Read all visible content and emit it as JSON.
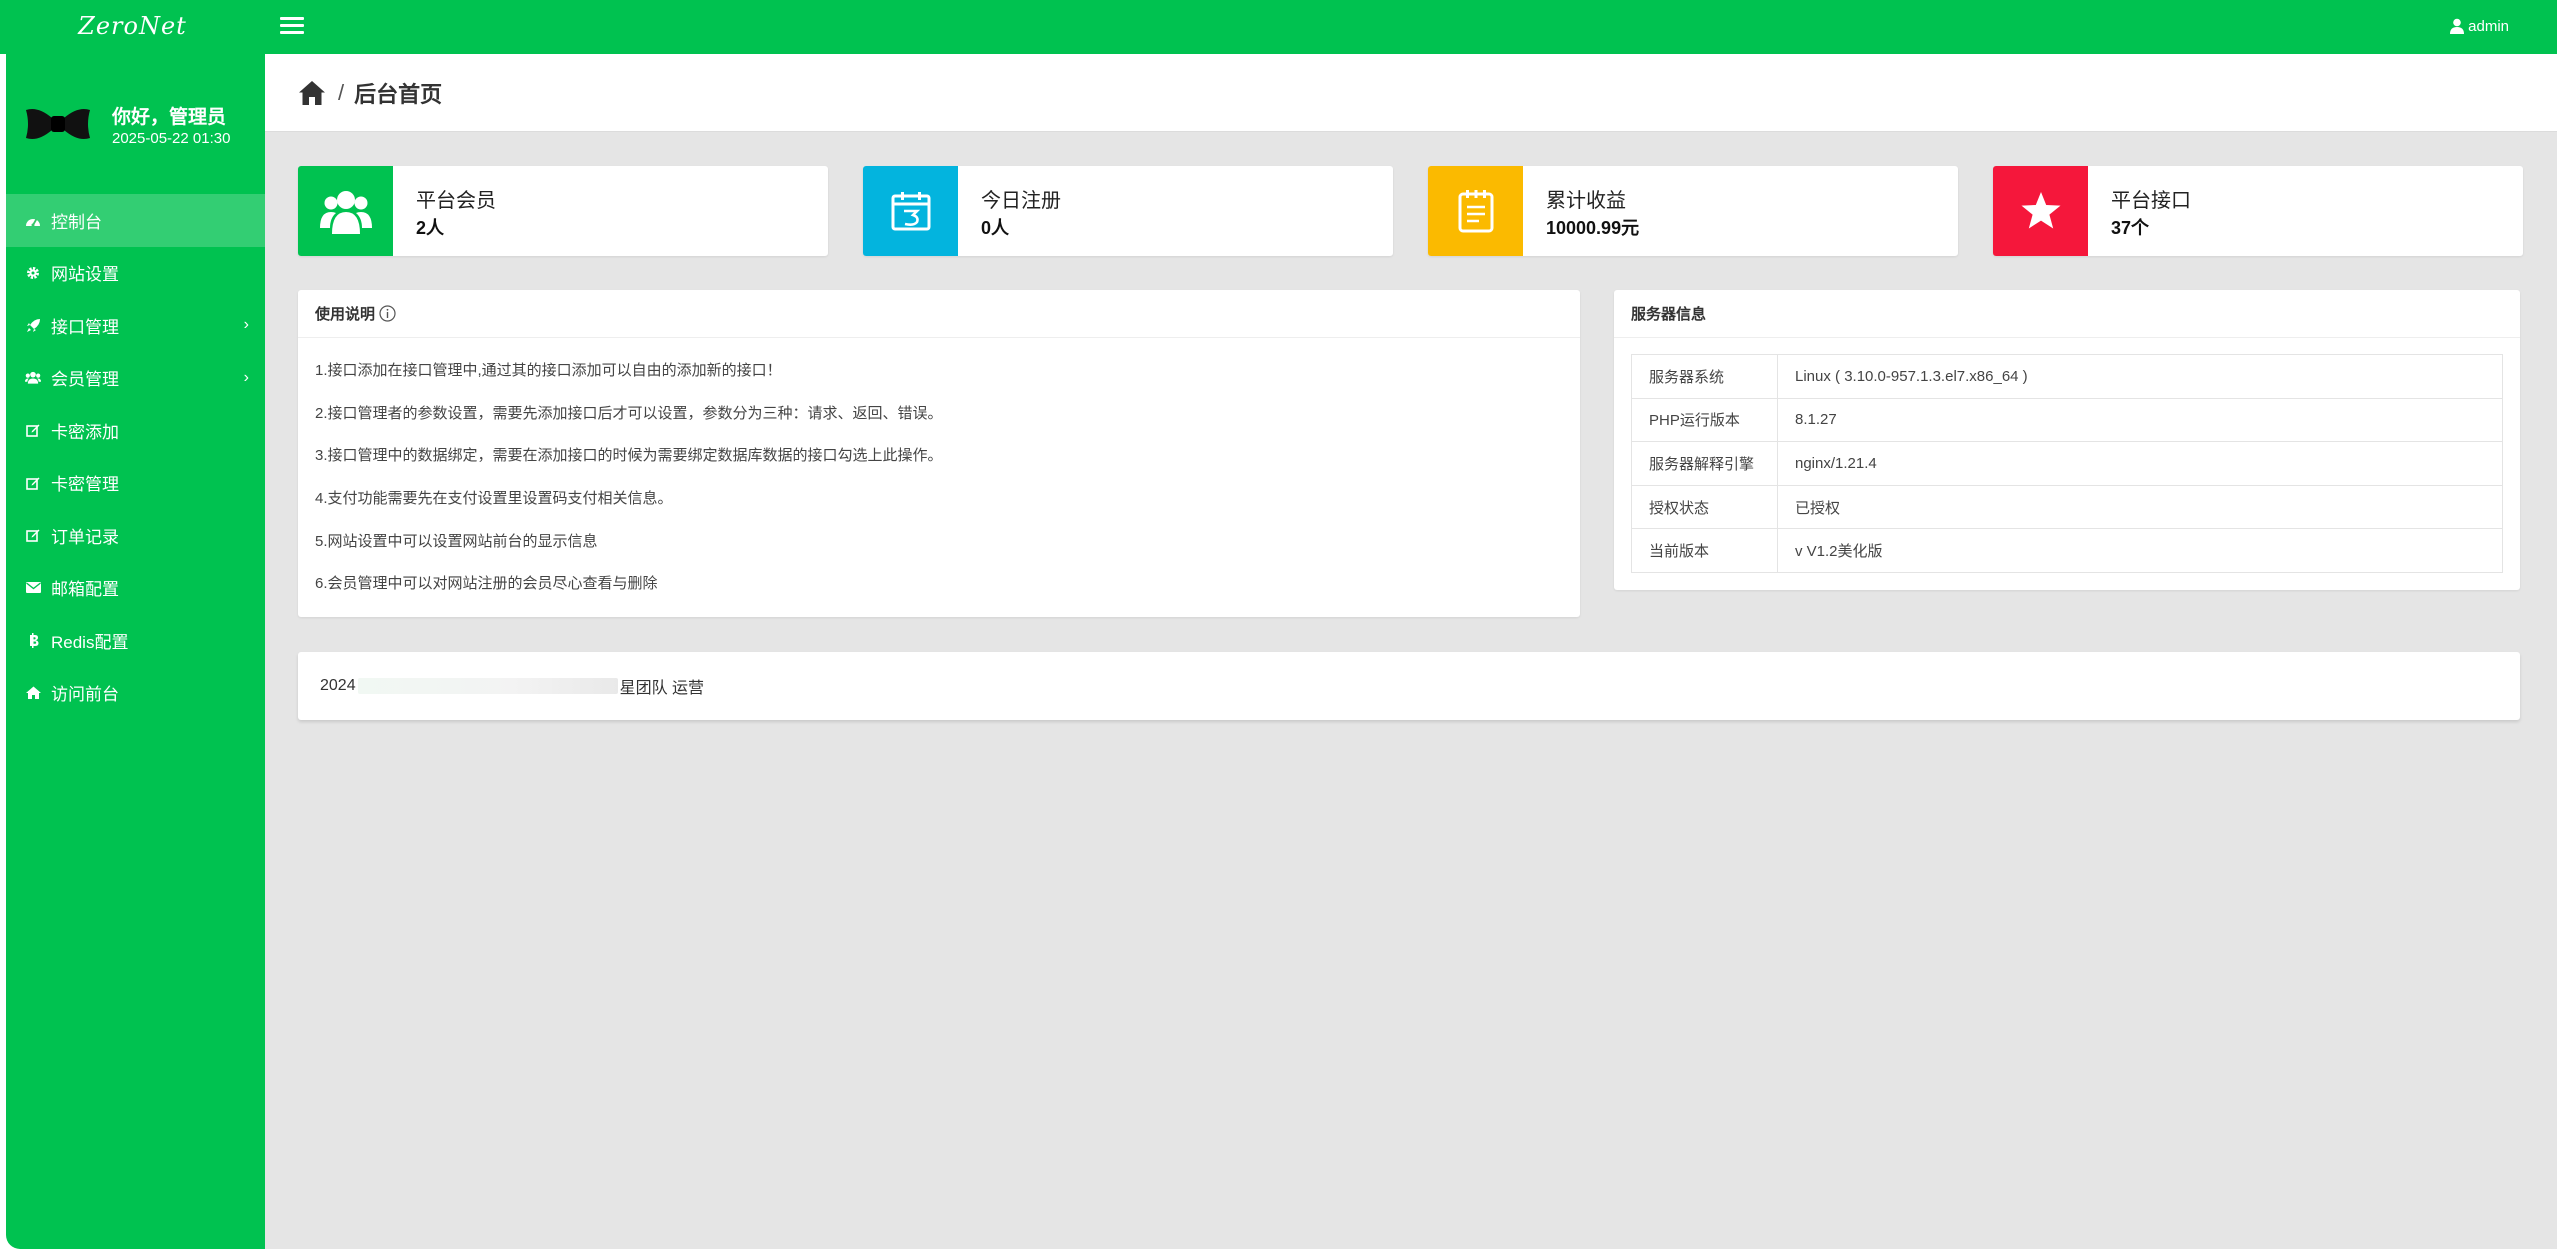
{
  "top": {
    "logo": "ZeroNet",
    "user": "admin"
  },
  "sidebar": {
    "greeting": "你好，管理员",
    "datetime": "2025-05-22 01:30",
    "items": [
      {
        "label": "控制台",
        "icon": "dashboard-icon",
        "active": true
      },
      {
        "label": "网站设置",
        "icon": "gear-icon"
      },
      {
        "label": "接口管理",
        "icon": "rocket-icon",
        "has_children": true
      },
      {
        "label": "会员管理",
        "icon": "users-icon",
        "has_children": true
      },
      {
        "label": "卡密添加",
        "icon": "edit-icon"
      },
      {
        "label": "卡密管理",
        "icon": "edit-icon"
      },
      {
        "label": "订单记录",
        "icon": "edit-icon"
      },
      {
        "label": "邮箱配置",
        "icon": "envelope-icon"
      },
      {
        "label": "Redis配置",
        "icon": "bitcoin-icon"
      },
      {
        "label": "访问前台",
        "icon": "home-icon"
      }
    ]
  },
  "breadcrumb": {
    "separator": "/",
    "current": "后台首页"
  },
  "stats": [
    {
      "label": "平台会员",
      "value": "2人",
      "color": "#00c250",
      "icon": "users-icon"
    },
    {
      "label": "今日注册",
      "value": "0人",
      "color": "#03b4de",
      "icon": "calendar-icon"
    },
    {
      "label": "累计收益",
      "value": "10000.99元",
      "color": "#fbba00",
      "icon": "notepad-icon"
    },
    {
      "label": "平台接口",
      "value": "37个",
      "color": "#f5173b",
      "icon": "star-icon"
    }
  ],
  "usage": {
    "title": "使用说明",
    "lines": [
      "1.接口添加在接口管理中,通过其的接口添加可以自由的添加新的接口！",
      "2.接口管理者的参数设置，需要先添加接口后才可以设置，参数分为三种：请求、返回、错误。",
      "3.接口管理中的数据绑定，需要在添加接口的时候为需要绑定数据库数据的接口勾选上此操作。",
      "4.支付功能需要先在支付设置里设置码支付相关信息。",
      "5.网站设置中可以设置网站前台的显示信息",
      "6.会员管理中可以对网站注册的会员尽心查看与删除"
    ]
  },
  "server": {
    "title": "服务器信息",
    "rows": [
      {
        "key": "服务器系统",
        "value": "Linux ( 3.10.0-957.1.3.el7.x86_64 )"
      },
      {
        "key": "PHP运行版本",
        "value": "8.1.27"
      },
      {
        "key": "服务器解释引擎",
        "value": "nginx/1.21.4"
      },
      {
        "key": "授权状态",
        "value": "已授权"
      },
      {
        "key": "当前版本",
        "value": "v V1.2美化版"
      }
    ]
  },
  "footer": {
    "prefix": "2024",
    "suffix": "星团队 运营"
  },
  "colors": {
    "primary": "#00c250",
    "background": "#e5e5e5"
  }
}
